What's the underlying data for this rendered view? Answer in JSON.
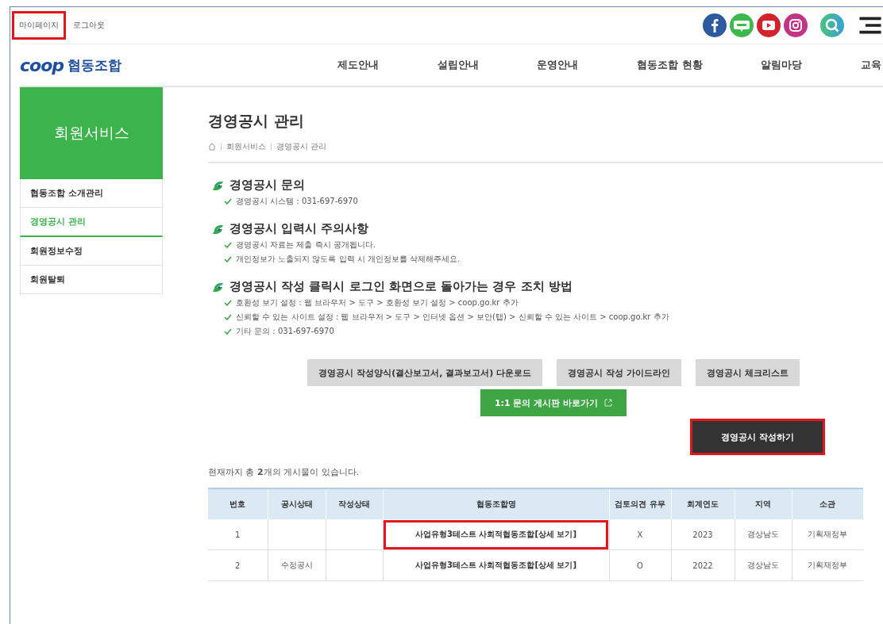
{
  "top_links": [
    {
      "label": "마이페이지",
      "highlighted": true
    },
    {
      "label": "로그아웃",
      "highlighted": false
    }
  ],
  "social": [
    {
      "kind": "facebook",
      "color": "#2d5a9e"
    },
    {
      "kind": "blog",
      "color": "#3cb94a"
    },
    {
      "kind": "youtube",
      "color": "#d0232b"
    },
    {
      "kind": "instagram",
      "color": "#c13584"
    }
  ],
  "logo": {
    "mark": "coop",
    "name": "협동조합"
  },
  "nav": [
    "제도안내",
    "설립안내",
    "운영안내",
    "협동조합 현황",
    "알림마당",
    "교육"
  ],
  "sidebar": {
    "title": "회원서비스",
    "items": [
      {
        "label": "협동조합 소개관리",
        "selected": false
      },
      {
        "label": "경영공시 관리",
        "selected": true
      },
      {
        "label": "회원정보수정",
        "selected": false
      },
      {
        "label": "회원탈퇴",
        "selected": false
      }
    ]
  },
  "page_title": "경영공시 관리",
  "breadcrumb": [
    "회원서비스",
    "경영공시 관리"
  ],
  "sections": [
    {
      "title": "경영공시 문의",
      "items": [
        "경영공시 시스템 : 031-697-6970"
      ]
    },
    {
      "title": "경영공시 입력시 주의사항",
      "items": [
        "경영공시 자료는 제출 즉시 공개됩니다.",
        "개인정보가 노출되지 않도록 입력 시 개인정보를 삭제해주세요."
      ]
    },
    {
      "title": "경영공시 작성 클릭시 로그인 화면으로 돌아가는 경우 조치 방법",
      "items": [
        "호환성 보기 설정 : 웹 브라우저 > 도구 > 호환성 보기 설정 > coop.go.kr 추가",
        "신뢰할 수 있는 사이트 설정 : 웹 브라우저 > 도구 > 인터넷 옵션 > 보안(탭) > 신뢰할 수 있는 사이트 > coop.go.kr 추가",
        "기타 문의 : 031-697-6970"
      ]
    }
  ],
  "downloads": [
    "경영공시 작성양식(결산보고서, 결과보고서) 다운로드",
    "경영공시 작성 가이드라인",
    "경영공시 체크리스트"
  ],
  "board_link": "1:1 문의 게시판 바로가기",
  "write_button": {
    "label": "경영공시 작성하기",
    "highlighted": true
  },
  "count_text": "현재까지 총 **2**개의 게시물이 있습니다.",
  "table": {
    "columns": [
      "번호",
      "공시상태",
      "작성상태",
      "협동조합명",
      "검토의견 유무",
      "회계연도",
      "지역",
      "소관"
    ],
    "rows": [
      {
        "cells": [
          "1",
          "",
          "",
          "사업유형3테스트 사회적협동조합[상세 보기]",
          "X",
          "2023",
          "경상남도",
          "기획재정부"
        ],
        "highlighted": true
      },
      {
        "cells": [
          "2",
          "수정공시",
          "",
          "사업유형3테스트 사회적협동조합[상세 보기]",
          "O",
          "2022",
          "경상남도",
          "기획재정부"
        ],
        "highlighted": false
      }
    ]
  }
}
